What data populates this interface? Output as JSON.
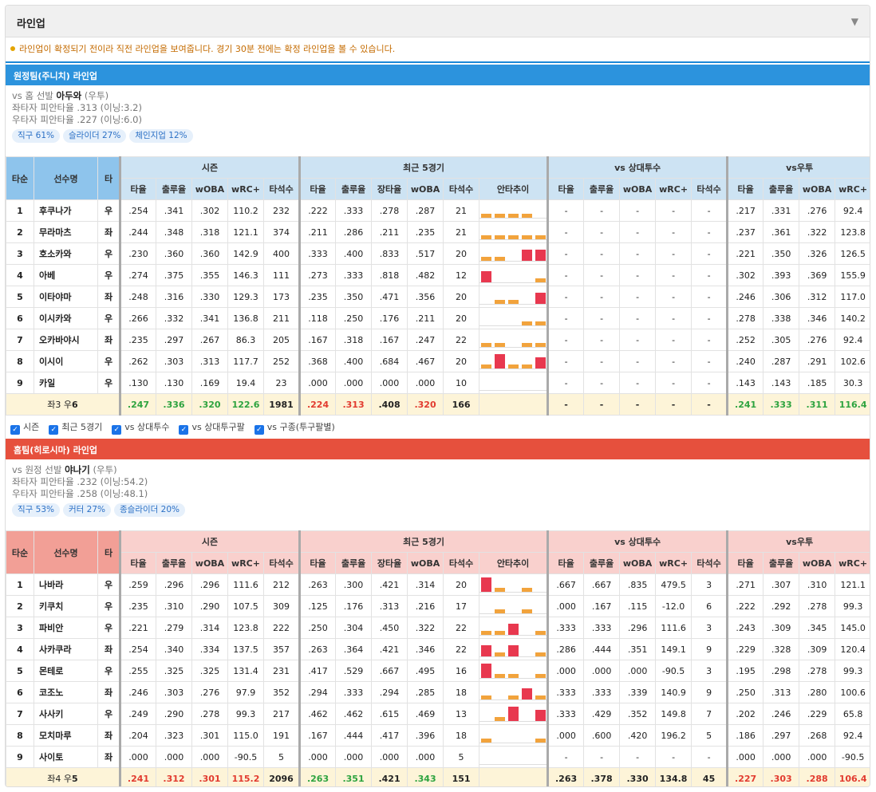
{
  "header": {
    "title": "라인업"
  },
  "notice": "라인업이 확정되기 전이라 직전 라인업을 보여줍니다. 경기 30분 전에는 확정 라인업을 볼 수 있습니다.",
  "columns": {
    "order": "타순",
    "player": "선수명",
    "hand": "타",
    "groups": [
      "시즌",
      "최근 5경기",
      "vs 상대투수",
      "vs우투"
    ],
    "season": [
      "타율",
      "출루율",
      "wOBA",
      "wRC+",
      "타석수"
    ],
    "recent": [
      "타율",
      "출루율",
      "장타율",
      "wOBA",
      "타석수",
      "안타추이"
    ],
    "vspitcher": [
      "타율",
      "출루율",
      "wOBA",
      "wRC+",
      "타석수"
    ],
    "vshand": [
      "타율",
      "출루율",
      "wOBA",
      "wRC+"
    ]
  },
  "away": {
    "title": "원정팀(주니치) 라인업",
    "pitcher_prefix": "vs 홈 선발",
    "pitcher_name": "아두와",
    "pitcher_hand": "(우투)",
    "line1": "좌타자 피안타율 .313 (이닝:3.2)",
    "line2": "우타자 피안타율 .227 (이닝:6.0)",
    "chips": [
      "직구 61%",
      "슬라이더 27%",
      "체인지업 12%"
    ],
    "rows": [
      {
        "n": "1",
        "name": "후쿠나가",
        "h": "우",
        "s": [
          ".254",
          ".341",
          ".302",
          "110.2",
          "232"
        ],
        "r": [
          ".222",
          ".333",
          ".278",
          ".287",
          "21"
        ],
        "trend": [
          1,
          1,
          1,
          1,
          0
        ],
        "p": [
          "-",
          "-",
          "-",
          "-",
          "-"
        ],
        "v": [
          ".217",
          ".331",
          ".276",
          "92.4"
        ]
      },
      {
        "n": "2",
        "name": "무라마츠",
        "h": "좌",
        "s": [
          ".244",
          ".348",
          ".318",
          "121.1",
          "374"
        ],
        "r": [
          ".211",
          ".286",
          ".211",
          ".235",
          "21"
        ],
        "trend": [
          1,
          1,
          1,
          1,
          1
        ],
        "p": [
          "-",
          "-",
          "-",
          "-",
          "-"
        ],
        "v": [
          ".237",
          ".361",
          ".322",
          "123.8"
        ]
      },
      {
        "n": "3",
        "name": "호소카와",
        "h": "우",
        "s": [
          ".230",
          ".360",
          ".360",
          "142.9",
          "400"
        ],
        "r": [
          ".333",
          ".400",
          ".833",
          ".517",
          "20"
        ],
        "trend": [
          1,
          1,
          0,
          2,
          2
        ],
        "p": [
          "-",
          "-",
          "-",
          "-",
          "-"
        ],
        "v": [
          ".221",
          ".350",
          ".326",
          "126.5"
        ]
      },
      {
        "n": "4",
        "name": "아베",
        "h": "우",
        "s": [
          ".274",
          ".375",
          ".355",
          "146.3",
          "111"
        ],
        "r": [
          ".273",
          ".333",
          ".818",
          ".482",
          "12"
        ],
        "trend": [
          2,
          0,
          0,
          0,
          1
        ],
        "p": [
          "-",
          "-",
          "-",
          "-",
          "-"
        ],
        "v": [
          ".302",
          ".393",
          ".369",
          "155.9"
        ]
      },
      {
        "n": "5",
        "name": "이타야마",
        "h": "좌",
        "s": [
          ".248",
          ".316",
          ".330",
          "129.3",
          "173"
        ],
        "r": [
          ".235",
          ".350",
          ".471",
          ".356",
          "20"
        ],
        "trend": [
          0,
          1,
          1,
          0,
          2
        ],
        "p": [
          "-",
          "-",
          "-",
          "-",
          "-"
        ],
        "v": [
          ".246",
          ".306",
          ".312",
          "117.0"
        ]
      },
      {
        "n": "6",
        "name": "이시카와",
        "h": "우",
        "s": [
          ".266",
          ".332",
          ".341",
          "136.8",
          "211"
        ],
        "r": [
          ".118",
          ".250",
          ".176",
          ".211",
          "20"
        ],
        "trend": [
          0,
          0,
          0,
          1,
          1
        ],
        "p": [
          "-",
          "-",
          "-",
          "-",
          "-"
        ],
        "v": [
          ".278",
          ".338",
          ".346",
          "140.2"
        ]
      },
      {
        "n": "7",
        "name": "오카바야시",
        "h": "좌",
        "s": [
          ".235",
          ".297",
          ".267",
          "86.3",
          "205"
        ],
        "r": [
          ".167",
          ".318",
          ".167",
          ".247",
          "22"
        ],
        "trend": [
          1,
          1,
          0,
          1,
          1
        ],
        "p": [
          "-",
          "-",
          "-",
          "-",
          "-"
        ],
        "v": [
          ".252",
          ".305",
          ".276",
          "92.4"
        ]
      },
      {
        "n": "8",
        "name": "이시이",
        "h": "우",
        "s": [
          ".262",
          ".303",
          ".313",
          "117.7",
          "252"
        ],
        "r": [
          ".368",
          ".400",
          ".684",
          ".467",
          "20"
        ],
        "trend": [
          1,
          3,
          1,
          1,
          2
        ],
        "p": [
          "-",
          "-",
          "-",
          "-",
          "-"
        ],
        "v": [
          ".240",
          ".287",
          ".291",
          "102.6"
        ]
      },
      {
        "n": "9",
        "name": "카일",
        "h": "우",
        "s": [
          ".130",
          ".130",
          ".169",
          "19.4",
          "23"
        ],
        "r": [
          ".000",
          ".000",
          ".000",
          ".000",
          "10"
        ],
        "trend": [
          0,
          0,
          0,
          0,
          0
        ],
        "p": [
          "-",
          "-",
          "-",
          "-",
          "-"
        ],
        "v": [
          ".143",
          ".143",
          ".185",
          "30.3"
        ]
      }
    ],
    "total": {
      "label_a": "좌3 우",
      "label_b": "6",
      "s": [
        ".247",
        ".336",
        ".320",
        "122.6",
        "1981"
      ],
      "r": [
        ".224",
        ".313",
        ".408",
        ".320",
        "166"
      ],
      "p": [
        "-",
        "-",
        "-",
        "-",
        "-"
      ],
      "v": [
        ".241",
        ".333",
        ".311",
        "116.4"
      ]
    }
  },
  "checks": [
    "시즌",
    "최근 5경기",
    "vs 상대투수",
    "vs 상대투구팔",
    "vs 구종(투구팔별)"
  ],
  "home": {
    "title": "홈팀(히로시마) 라인업",
    "pitcher_prefix": "vs 원정 선발",
    "pitcher_name": "야나기",
    "pitcher_hand": "(우투)",
    "line1": "좌타자 피안타율 .232 (이닝:54.2)",
    "line2": "우타자 피안타율 .258 (이닝:48.1)",
    "chips": [
      "직구 53%",
      "커터 27%",
      "종슬라이더 20%"
    ],
    "rows": [
      {
        "n": "1",
        "name": "나바라",
        "h": "우",
        "s": [
          ".259",
          ".296",
          ".296",
          "111.6",
          "212"
        ],
        "r": [
          ".263",
          ".300",
          ".421",
          ".314",
          "20"
        ],
        "trend": [
          3,
          1,
          0,
          1,
          0
        ],
        "p": [
          ".667",
          ".667",
          ".835",
          "479.5",
          "3"
        ],
        "v": [
          ".271",
          ".307",
          ".310",
          "121.1"
        ]
      },
      {
        "n": "2",
        "name": "키쿠치",
        "h": "우",
        "s": [
          ".235",
          ".310",
          ".290",
          "107.5",
          "309"
        ],
        "r": [
          ".125",
          ".176",
          ".313",
          ".216",
          "17"
        ],
        "trend": [
          0,
          1,
          0,
          1,
          0
        ],
        "p": [
          ".000",
          ".167",
          ".115",
          "-12.0",
          "6"
        ],
        "v": [
          ".222",
          ".292",
          ".278",
          "99.3"
        ]
      },
      {
        "n": "3",
        "name": "파비안",
        "h": "우",
        "s": [
          ".221",
          ".279",
          ".314",
          "123.8",
          "222"
        ],
        "r": [
          ".250",
          ".304",
          ".450",
          ".322",
          "22"
        ],
        "trend": [
          1,
          1,
          2,
          0,
          1
        ],
        "p": [
          ".333",
          ".333",
          ".296",
          "111.6",
          "3"
        ],
        "v": [
          ".243",
          ".309",
          ".345",
          "145.0"
        ]
      },
      {
        "n": "4",
        "name": "사카쿠라",
        "h": "좌",
        "s": [
          ".254",
          ".340",
          ".334",
          "137.5",
          "357"
        ],
        "r": [
          ".263",
          ".364",
          ".421",
          ".346",
          "22"
        ],
        "trend": [
          2,
          1,
          2,
          0,
          1
        ],
        "p": [
          ".286",
          ".444",
          ".351",
          "149.1",
          "9"
        ],
        "v": [
          ".229",
          ".328",
          ".309",
          "120.4"
        ]
      },
      {
        "n": "5",
        "name": "몬테로",
        "h": "우",
        "s": [
          ".255",
          ".325",
          ".325",
          "131.4",
          "231"
        ],
        "r": [
          ".417",
          ".529",
          ".667",
          ".495",
          "16"
        ],
        "trend": [
          3,
          1,
          1,
          0,
          1
        ],
        "p": [
          ".000",
          ".000",
          ".000",
          "-90.5",
          "3"
        ],
        "v": [
          ".195",
          ".298",
          ".278",
          "99.3"
        ]
      },
      {
        "n": "6",
        "name": "코조노",
        "h": "좌",
        "s": [
          ".246",
          ".303",
          ".276",
          "97.9",
          "352"
        ],
        "r": [
          ".294",
          ".333",
          ".294",
          ".285",
          "18"
        ],
        "trend": [
          1,
          0,
          1,
          2,
          1
        ],
        "p": [
          ".333",
          ".333",
          ".339",
          "140.9",
          "9"
        ],
        "v": [
          ".250",
          ".313",
          ".280",
          "100.6"
        ]
      },
      {
        "n": "7",
        "name": "사사키",
        "h": "우",
        "s": [
          ".249",
          ".290",
          ".278",
          "99.3",
          "217"
        ],
        "r": [
          ".462",
          ".462",
          ".615",
          ".469",
          "13"
        ],
        "trend": [
          0,
          1,
          3,
          0,
          2
        ],
        "p": [
          ".333",
          ".429",
          ".352",
          "149.8",
          "7"
        ],
        "v": [
          ".202",
          ".246",
          ".229",
          "65.8"
        ]
      },
      {
        "n": "8",
        "name": "모치마루",
        "h": "좌",
        "s": [
          ".204",
          ".323",
          ".301",
          "115.0",
          "191"
        ],
        "r": [
          ".167",
          ".444",
          ".417",
          ".396",
          "18"
        ],
        "trend": [
          1,
          0,
          0,
          0,
          1
        ],
        "p": [
          ".000",
          ".600",
          ".420",
          "196.2",
          "5"
        ],
        "v": [
          ".186",
          ".297",
          ".268",
          "92.4"
        ]
      },
      {
        "n": "9",
        "name": "사이토",
        "h": "좌",
        "s": [
          ".000",
          ".000",
          ".000",
          "-90.5",
          "5"
        ],
        "r": [
          ".000",
          ".000",
          ".000",
          ".000",
          "5"
        ],
        "trend": [
          0,
          0,
          0,
          0,
          0
        ],
        "p": [
          "-",
          "-",
          "-",
          "-",
          "-"
        ],
        "v": [
          ".000",
          ".000",
          ".000",
          "-90.5"
        ]
      }
    ],
    "total": {
      "label_a": "좌4 우",
      "label_b": "5",
      "s": [
        ".241",
        ".312",
        ".301",
        "115.2",
        "2096"
      ],
      "r": [
        ".263",
        ".351",
        ".421",
        ".343",
        "151"
      ],
      "p": [
        ".263",
        ".378",
        ".330",
        "134.8",
        "45"
      ],
      "v": [
        ".227",
        ".303",
        ".288",
        "106.4"
      ]
    }
  },
  "colors": {
    "away": "#2c93dd",
    "home": "#e6503d",
    "hit_single": "#f2a33c",
    "hit_extra": "#e8384f",
    "good": "#2da33f",
    "bad": "#e23b2f"
  }
}
